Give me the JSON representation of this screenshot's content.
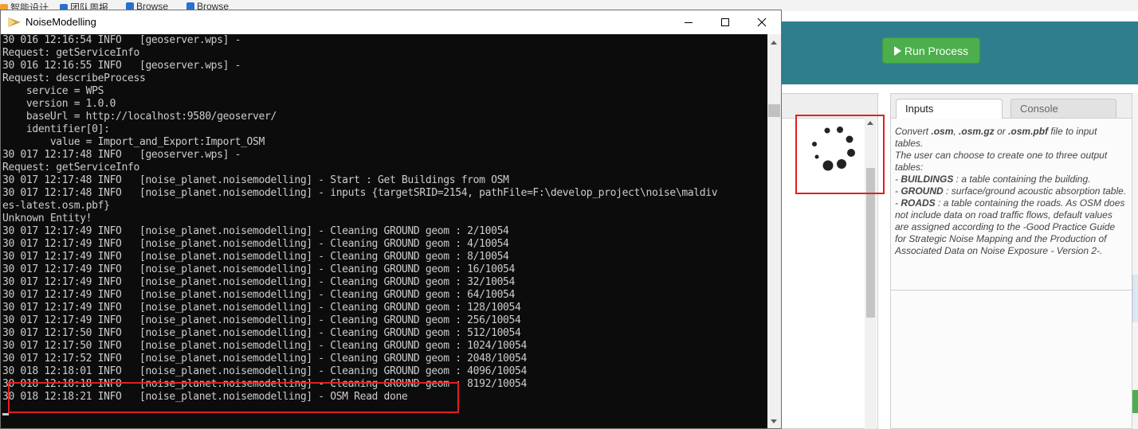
{
  "browser": {
    "bookmarks": [
      {
        "label": "智能设计"
      },
      {
        "label": "团队周报"
      },
      {
        "label": "Browse"
      },
      {
        "label": "Browse"
      }
    ]
  },
  "app": {
    "run_button": {
      "label": "Run Process"
    },
    "tabs": [
      {
        "label": "Inputs",
        "active": true
      },
      {
        "label": "Console",
        "active": false
      }
    ],
    "description": {
      "intro_prefix": "Convert ",
      "ext1": ".osm",
      "sep1": ", ",
      "ext2": ".osm.gz",
      "sep2": " or ",
      "ext3": ".osm.pbf",
      "intro_suffix": " file to input tables.",
      "choose": "The user can choose to create one to three output tables:",
      "buildings_dash": "- ",
      "buildings_key": "BUILDINGS",
      "buildings_text": " : a table containing the building.",
      "ground_dash": "- ",
      "ground_key": "GROUND",
      "ground_text": " : surface/ground acoustic absorption table.",
      "roads_dash": "- ",
      "roads_key": "ROADS",
      "roads_text": " : a table containing the roads. As OSM does not include data on road traffic flows, default values are assigned according to the -Good Practice Guide for Strategic Noise Mapping and the Production of Associated Data on Noise Exposure - Version 2-."
    },
    "colors": {
      "header": "#2f7e8d",
      "run_button": "#4cae4c",
      "highlight": "#e02020"
    }
  },
  "console": {
    "title": "NoiseModelling",
    "icon": "noisemodelling-app-icon",
    "lines": [
      "30 016 12:16:54 INFO   [geoserver.wps] -",
      "Request: getServiceInfo",
      "30 016 12:16:55 INFO   [geoserver.wps] -",
      "Request: describeProcess",
      "    service = WPS",
      "    version = 1.0.0",
      "    baseUrl = http://localhost:9580/geoserver/",
      "    identifier[0]:",
      "        value = Import_and_Export:Import_OSM",
      "30 017 12:17:48 INFO   [geoserver.wps] -",
      "Request: getServiceInfo",
      "30 017 12:17:48 INFO   [noise_planet.noisemodelling] - Start : Get Buildings from OSM",
      "30 017 12:17:48 INFO   [noise_planet.noisemodelling] - inputs {targetSRID=2154, pathFile=F:\\develop_project\\noise\\maldiv",
      "es-latest.osm.pbf}",
      "Unknown Entity!",
      "30 017 12:17:49 INFO   [noise_planet.noisemodelling] - Cleaning GROUND geom : 2/10054",
      "30 017 12:17:49 INFO   [noise_planet.noisemodelling] - Cleaning GROUND geom : 4/10054",
      "30 017 12:17:49 INFO   [noise_planet.noisemodelling] - Cleaning GROUND geom : 8/10054",
      "30 017 12:17:49 INFO   [noise_planet.noisemodelling] - Cleaning GROUND geom : 16/10054",
      "30 017 12:17:49 INFO   [noise_planet.noisemodelling] - Cleaning GROUND geom : 32/10054",
      "30 017 12:17:49 INFO   [noise_planet.noisemodelling] - Cleaning GROUND geom : 64/10054",
      "30 017 12:17:49 INFO   [noise_planet.noisemodelling] - Cleaning GROUND geom : 128/10054",
      "30 017 12:17:49 INFO   [noise_planet.noisemodelling] - Cleaning GROUND geom : 256/10054",
      "30 017 12:17:50 INFO   [noise_planet.noisemodelling] - Cleaning GROUND geom : 512/10054",
      "30 017 12:17:50 INFO   [noise_planet.noisemodelling] - Cleaning GROUND geom : 1024/10054",
      "30 017 12:17:52 INFO   [noise_planet.noisemodelling] - Cleaning GROUND geom : 2048/10054",
      "30 018 12:18:01 INFO   [noise_planet.noisemodelling] - Cleaning GROUND geom : 4096/10054",
      "30 018 12:18:18 INFO   [noise_planet.noisemodelling] - Cleaning GROUND geom : 8192/10054",
      "30 018 12:18:21 INFO   [noise_planet.noisemodelling] - OSM Read done"
    ]
  }
}
